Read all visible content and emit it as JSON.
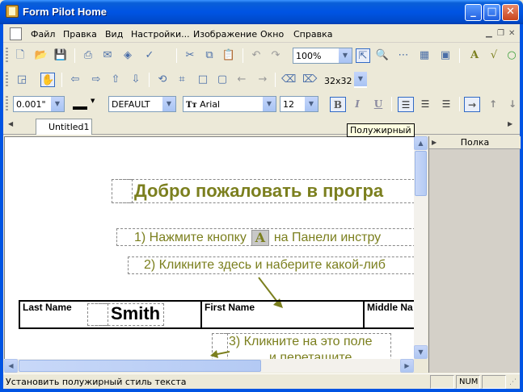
{
  "window": {
    "title": "Form Pilot Home"
  },
  "menu": [
    "Файл",
    "Правка",
    "Вид",
    "Настройки...",
    "Изображение",
    "Окно",
    "Справка"
  ],
  "toolbar1": {
    "zoom": "100%"
  },
  "toolbar2": {
    "grid_size": "32x32"
  },
  "toolbar3": {
    "line_width": "0.001\"",
    "style": "DEFAULT",
    "font": "Arial",
    "font_size": "12"
  },
  "tooltip": "Полужирный",
  "tabs": [
    {
      "label": "Untitled1"
    }
  ],
  "document": {
    "welcome": "Добро пожаловать в програ",
    "step1_a": "1) Нажмите кнопку",
    "step1_b": "на Панели инстру",
    "step1_btn": "A",
    "step2": "2) Кликните здесь и наберите какой-либ",
    "step3_a": "3) Кликните на это поле",
    "step3_b": "и перетащите",
    "fields": {
      "last_name": "Last Name",
      "first_name": "First Name",
      "middle_name": "Middle Na"
    },
    "value": "Smith"
  },
  "panel": {
    "title": "Полка"
  },
  "status": {
    "text": "Установить полужирный стиль текста",
    "num": "NUM"
  },
  "colors": {
    "title_bar": "#0054e3",
    "doc_text": "#7b7f1e",
    "tab_bg": "#ffffff"
  }
}
